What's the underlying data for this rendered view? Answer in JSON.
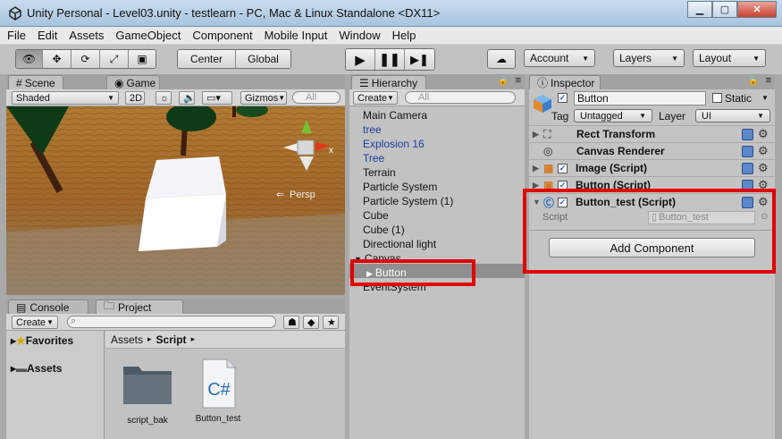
{
  "window": {
    "title": "Unity Personal - Level03.unity - testlearn - PC, Mac & Linux Standalone <DX11>"
  },
  "menu": [
    "File",
    "Edit",
    "Assets",
    "GameObject",
    "Component",
    "Mobile Input",
    "Window",
    "Help"
  ],
  "toolbar": {
    "pivot": "Center",
    "space": "Global",
    "account": "Account",
    "layers": "Layers",
    "layout": "Layout"
  },
  "scene": {
    "tab_scene": "Scene",
    "tab_game": "Game",
    "shading": "Shaded",
    "mode_2d": "2D",
    "gizmos": "Gizmos",
    "search_placeholder": "All",
    "persp": "Persp",
    "gizmo_axis": "x"
  },
  "hierarchy": {
    "tab": "Hierarchy",
    "create": "Create",
    "search_placeholder": "All",
    "items": [
      "Main Camera",
      "tree",
      "Explosion 16",
      "Tree",
      "Terrain",
      "Particle System",
      "Particle System (1)",
      "Cube",
      "Cube (1)",
      "Directional light",
      "Canvas",
      "Button",
      "EventSystem"
    ]
  },
  "inspector": {
    "tab": "Inspector",
    "name": "Button",
    "static_label": "Static",
    "tag_label": "Tag",
    "tag_value": "Untagged",
    "layer_label": "Layer",
    "layer_value": "UI",
    "components": [
      "Rect Transform",
      "Canvas Renderer",
      "Image (Script)",
      "Button (Script)",
      "Button_test (Script)"
    ],
    "script_label": "Script",
    "script_value": "Button_test",
    "add_component": "Add Component"
  },
  "bottom": {
    "tab_console": "Console",
    "tab_project": "Project",
    "create": "Create",
    "favorites": "Favorites",
    "assets": "Assets",
    "breadcrumb_root": "Assets",
    "breadcrumb_current": "Script",
    "files": [
      "script_bak",
      "Button_test"
    ],
    "file_badge": "C#"
  },
  "colors": {
    "highlight": "#e00000",
    "selection": "#8f8f8f",
    "prefab_blue": "#1a3d9e"
  }
}
